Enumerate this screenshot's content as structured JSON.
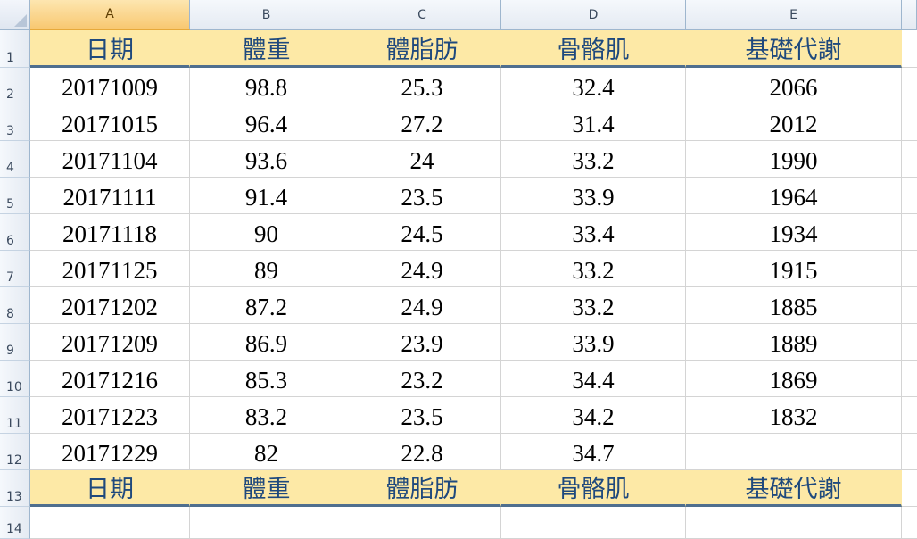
{
  "columns": [
    "A",
    "B",
    "C",
    "D",
    "E"
  ],
  "active_column": "A",
  "row_numbers": [
    "1",
    "2",
    "3",
    "4",
    "5",
    "6",
    "7",
    "8",
    "9",
    "10",
    "11",
    "12",
    "13",
    "14"
  ],
  "header": [
    "日期",
    "體重",
    "體脂肪",
    "骨骼肌",
    "基礎代謝"
  ],
  "rows": [
    [
      "20171009",
      "98.8",
      "25.3",
      "32.4",
      "2066"
    ],
    [
      "20171015",
      "96.4",
      "27.2",
      "31.4",
      "2012"
    ],
    [
      "20171104",
      "93.6",
      "24",
      "33.2",
      "1990"
    ],
    [
      "20171111",
      "91.4",
      "23.5",
      "33.9",
      "1964"
    ],
    [
      "20171118",
      "90",
      "24.5",
      "33.4",
      "1934"
    ],
    [
      "20171125",
      "89",
      "24.9",
      "33.2",
      "1915"
    ],
    [
      "20171202",
      "87.2",
      "24.9",
      "33.2",
      "1885"
    ],
    [
      "20171209",
      "86.9",
      "23.9",
      "33.9",
      "1889"
    ],
    [
      "20171216",
      "85.3",
      "23.2",
      "34.4",
      "1869"
    ],
    [
      "20171223",
      "83.2",
      "23.5",
      "34.2",
      "1832"
    ],
    [
      "20171229",
      "82",
      "22.8",
      "34.7",
      ""
    ]
  ],
  "footer": [
    "日期",
    "體重",
    "體脂肪",
    "骨骼肌",
    "基礎代謝"
  ],
  "colors": {
    "header_fill": "#fde9a6",
    "header_text": "#1f497d",
    "header_rule": "#4f6f8f",
    "active_column_fill": "#f8c871"
  }
}
